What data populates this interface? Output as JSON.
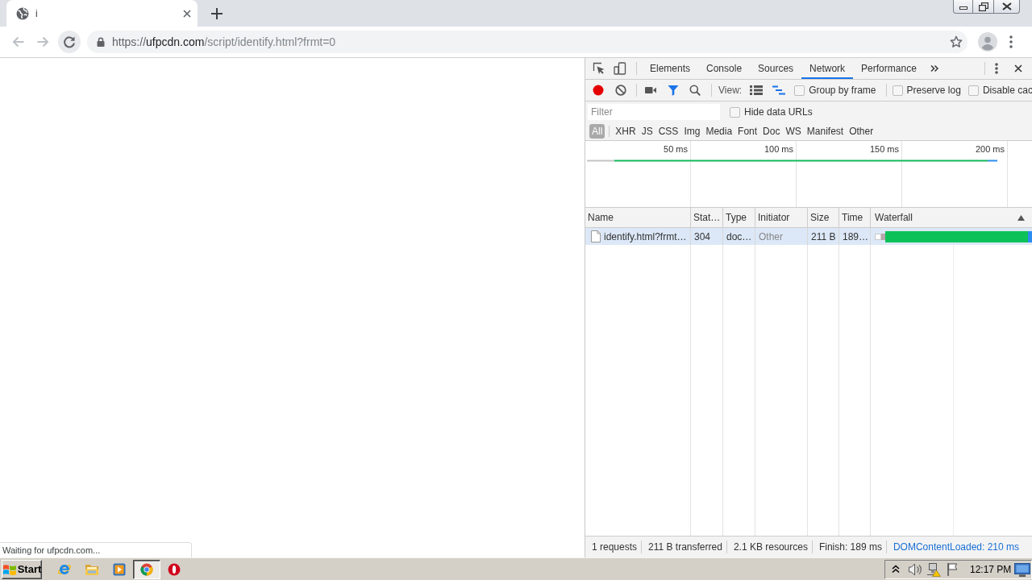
{
  "browser": {
    "tabs": [
      {
        "title": "i",
        "selected": true
      }
    ],
    "address_bar": {
      "scheme": "https://",
      "host": "ufpcdn.com",
      "path": "/script/identify.html?frmt=0"
    }
  },
  "page": {
    "status_bubble": "Waiting for ufpcdn.com..."
  },
  "devtools": {
    "tabs": [
      {
        "label": "Elements",
        "selected": false
      },
      {
        "label": "Console",
        "selected": false
      },
      {
        "label": "Sources",
        "selected": false
      },
      {
        "label": "Network",
        "selected": true
      },
      {
        "label": "Performance",
        "selected": false
      }
    ],
    "toolbar": {
      "recording": true,
      "filter_shown": true,
      "view_label": "View:",
      "view_modes": [
        {
          "kind": "large-rows",
          "on": false
        },
        {
          "kind": "overview",
          "on": true
        }
      ],
      "options": [
        {
          "label": "Group by frame",
          "checked": false
        },
        {
          "label": "Preserve log",
          "checked": false
        },
        {
          "label": "Disable cac",
          "checked": false
        }
      ]
    },
    "filter_bar": {
      "placeholder": "Filter",
      "hide_data_urls": {
        "label": "Hide data URLs",
        "checked": false
      },
      "types": [
        {
          "label": "All",
          "selected": true
        },
        {
          "label": "XHR",
          "selected": false
        },
        {
          "label": "JS",
          "selected": false
        },
        {
          "label": "CSS",
          "selected": false
        },
        {
          "label": "Img",
          "selected": false
        },
        {
          "label": "Media",
          "selected": false
        },
        {
          "label": "Font",
          "selected": false
        },
        {
          "label": "Doc",
          "selected": false
        },
        {
          "label": "WS",
          "selected": false
        },
        {
          "label": "Manifest",
          "selected": false
        },
        {
          "label": "Other",
          "selected": false
        }
      ]
    },
    "overview": {
      "ticks": [
        "50 ms",
        "100 ms",
        "150 ms",
        "200 ms"
      ]
    },
    "table": {
      "columns": [
        "Name",
        "Stat…",
        "Type",
        "Initiator",
        "Size",
        "Time",
        "Waterfall"
      ],
      "rows": [
        {
          "name": "identify.html?frmt…",
          "status": "304",
          "type": "doc…",
          "initiator": "Other",
          "size": "211 B",
          "time": "189…",
          "selected": true
        }
      ]
    },
    "summary": [
      {
        "kind": "stat",
        "text": "1 requests"
      },
      {
        "kind": "stat",
        "text": "211 B transferred"
      },
      {
        "kind": "stat",
        "text": "2.1 KB resources"
      },
      {
        "kind": "stat",
        "text": "Finish: 189 ms"
      },
      {
        "kind": "event",
        "text": "DOMContentLoaded: 210 ms"
      }
    ]
  },
  "taskbar": {
    "start_label": "Start",
    "apps": [
      {
        "kind": "browser-e",
        "selected": false
      },
      {
        "kind": "folder",
        "selected": false
      },
      {
        "kind": "player",
        "selected": false
      },
      {
        "kind": "browser-round",
        "selected": true
      },
      {
        "kind": "browser-o",
        "selected": false
      }
    ],
    "clock": "12:17 PM"
  }
}
